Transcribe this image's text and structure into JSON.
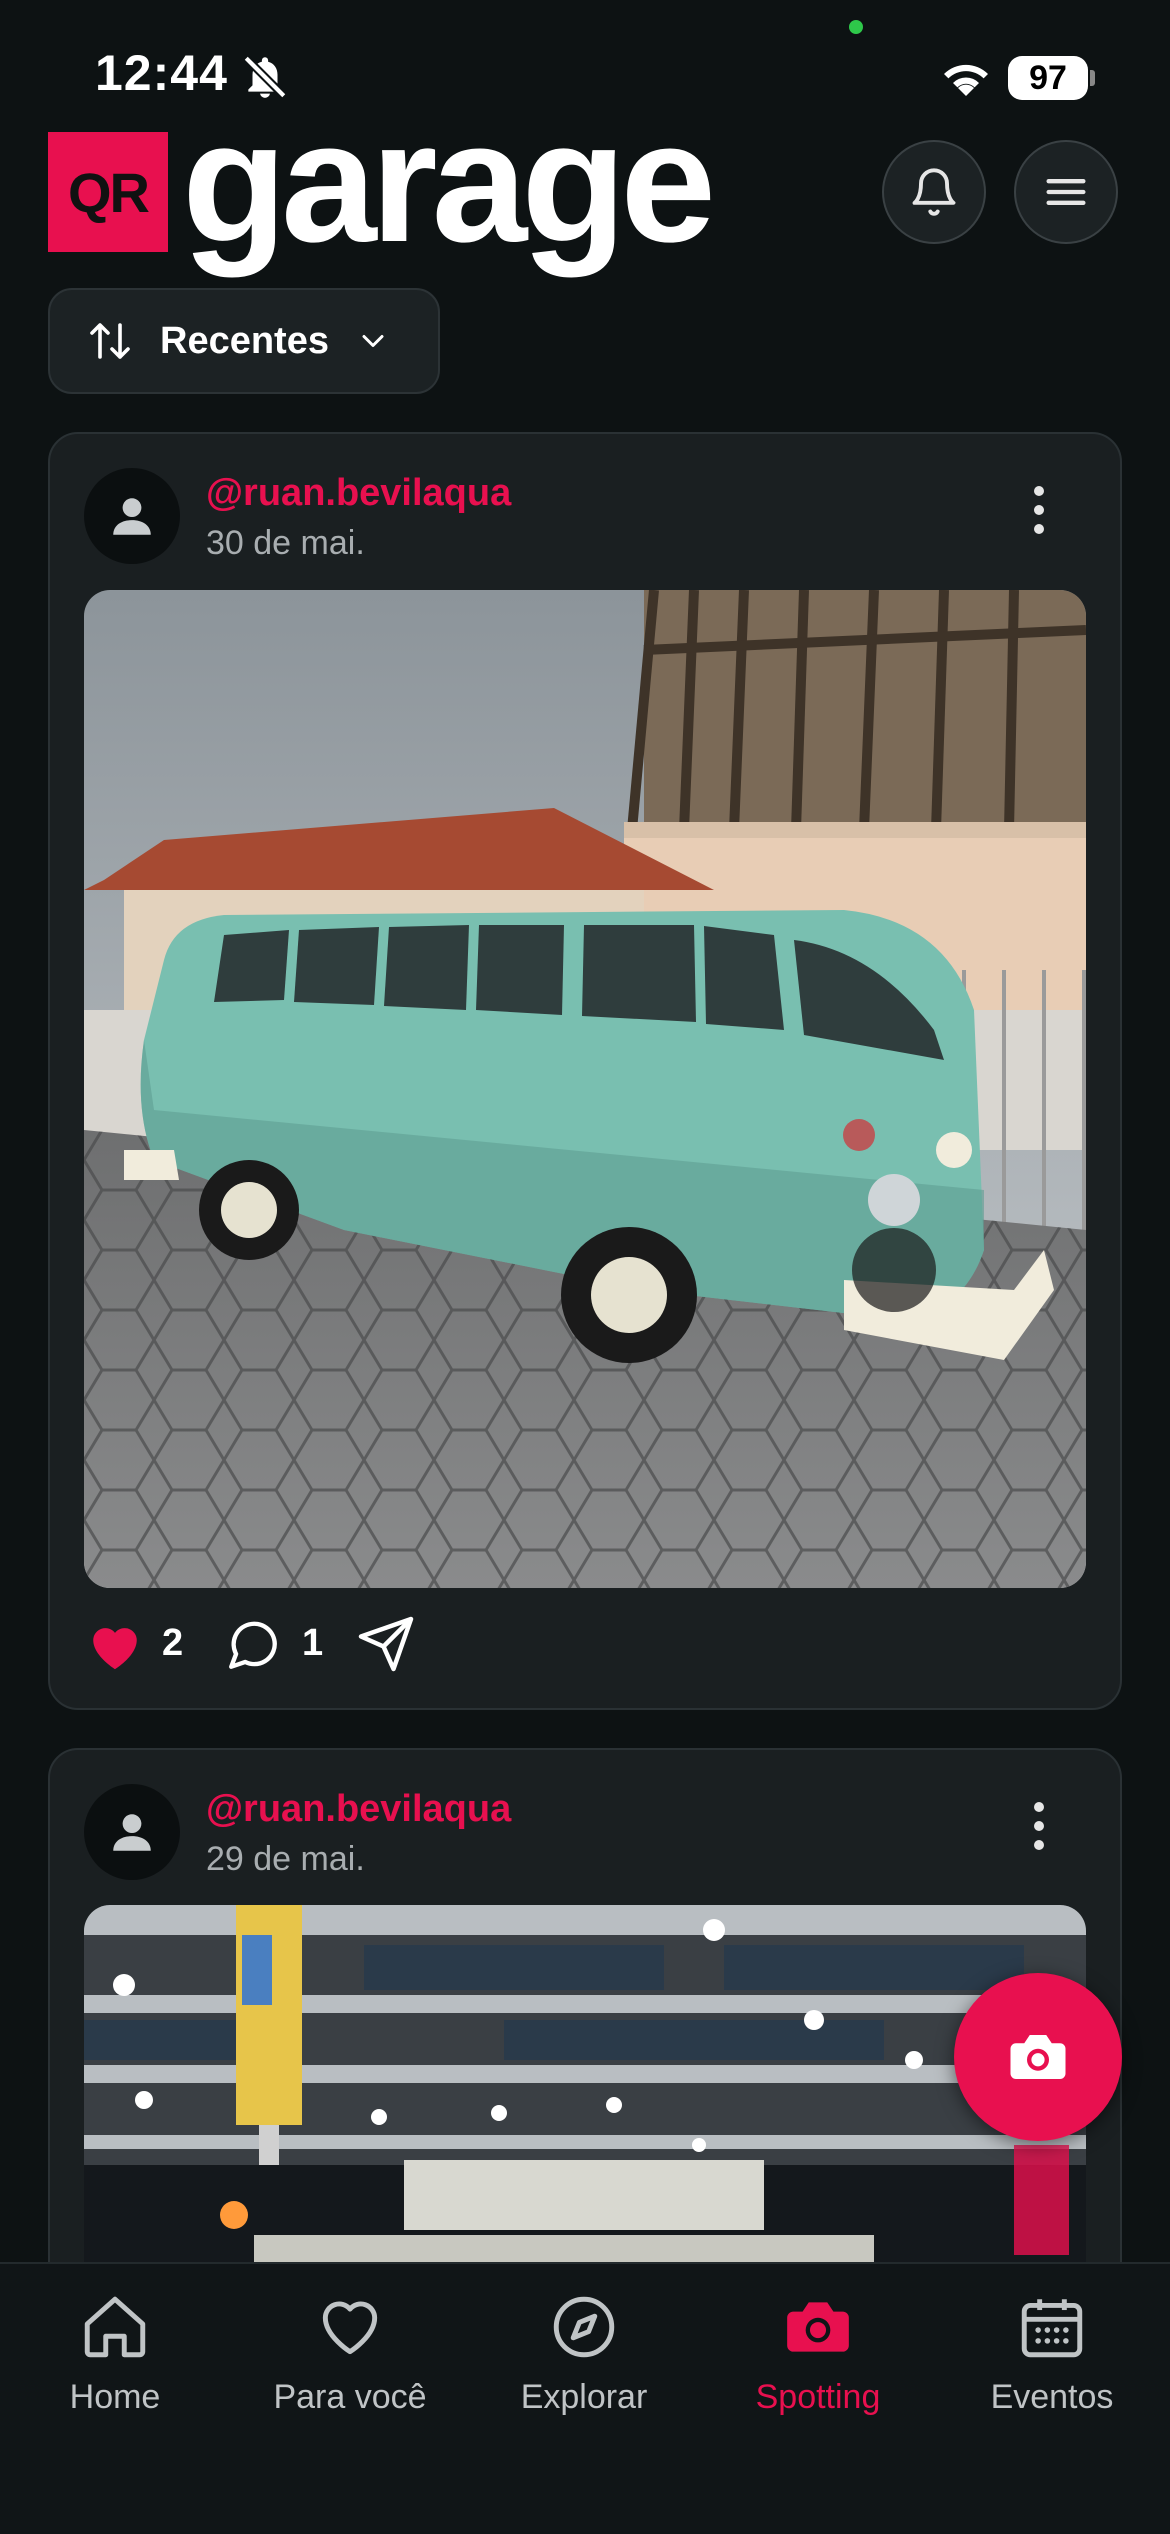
{
  "status_bar": {
    "time": "12:44",
    "battery": "97"
  },
  "header": {
    "logo_badge": "QR",
    "logo_word": "garage",
    "icons": [
      "bell-icon",
      "menu-icon"
    ]
  },
  "sort": {
    "label": "Recentes",
    "icon": "sort-arrows-icon"
  },
  "posts": [
    {
      "username": "@ruan.bevilaqua",
      "date": "30 de mai.",
      "likes": "2",
      "comments": "1",
      "liked": true
    },
    {
      "username": "@ruan.bevilaqua",
      "date": "29 de mai."
    }
  ],
  "fab": {
    "icon": "camera-icon"
  },
  "tabs": [
    {
      "label": "Home",
      "icon": "home-icon",
      "active": false
    },
    {
      "label": "Para você",
      "icon": "heart-icon",
      "active": false
    },
    {
      "label": "Explorar",
      "icon": "compass-icon",
      "active": false
    },
    {
      "label": "Spotting",
      "icon": "camera-icon",
      "active": true
    },
    {
      "label": "Eventos",
      "icon": "calendar-icon",
      "active": false
    }
  ],
  "colors": {
    "accent": "#e8104f",
    "background": "#0d1213",
    "card": "#1a1f21"
  }
}
